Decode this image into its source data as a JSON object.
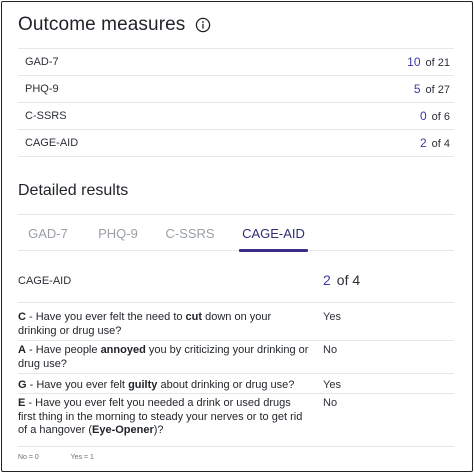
{
  "header": {
    "title": "Outcome measures",
    "info_icon": "info-icon"
  },
  "measures": [
    {
      "name": "GAD-7",
      "score": "10",
      "of": "of 21"
    },
    {
      "name": "PHQ-9",
      "score": "5",
      "of": "of 27"
    },
    {
      "name": "C-SSRS",
      "score": "0",
      "of": "of 6"
    },
    {
      "name": "CAGE-AID",
      "score": "2",
      "of": "of 4"
    }
  ],
  "detailed": {
    "title": "Detailed results",
    "tabs": [
      "GAD-7",
      "PHQ-9",
      "C-SSRS",
      "CAGE-AID"
    ],
    "active_tab": "CAGE-AID",
    "label": "CAGE-AID",
    "score": "2",
    "of": "of 4",
    "questions": [
      {
        "letter": "C",
        "pre": " - Have you ever felt the need to ",
        "bold": "cut",
        "post": " down on your drinking or drug use?",
        "answer": "Yes"
      },
      {
        "letter": "A",
        "pre": " - Have people ",
        "bold": "annoyed",
        "post": " you by criticizing your drinking or drug use?",
        "answer": "No"
      },
      {
        "letter": "G",
        "pre": " - Have you ever felt ",
        "bold": "guilty",
        "post": " about drinking or drug use?",
        "answer": "Yes"
      },
      {
        "letter": "E",
        "pre": " - Have you ever felt you needed a drink or used drugs first thing in the morning to steady your nerves or to get rid of a hangover (",
        "bold": "Eye-Opener",
        "post": ")?",
        "answer": "No"
      }
    ],
    "legend": {
      "no": "No = 0",
      "yes": "Yes = 1"
    }
  },
  "colors": {
    "accent": "#3a3aa6",
    "tab_underline": "#3b2d8a",
    "divider": "#e4e6ea",
    "muted": "#9aa0a6"
  }
}
